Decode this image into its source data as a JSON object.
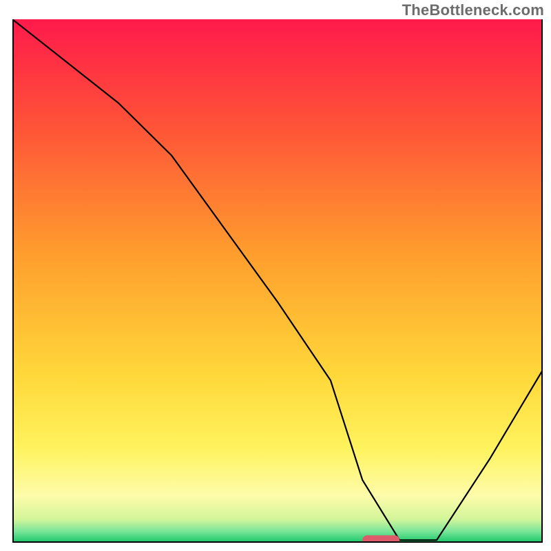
{
  "watermark": "TheBottleneck.com",
  "chart_data": {
    "type": "line",
    "title": "",
    "xlabel": "",
    "ylabel": "",
    "xlim": [
      0,
      100
    ],
    "ylim": [
      0,
      100
    ],
    "grid": false,
    "legend": null,
    "annotations": [],
    "x": [
      0,
      10,
      20,
      30,
      40,
      50,
      60,
      66,
      73,
      80,
      90,
      100
    ],
    "values": [
      100,
      92,
      84,
      74,
      60,
      46,
      31,
      12,
      0.5,
      0.5,
      16,
      33
    ],
    "marker": {
      "x_range": [
        66,
        73
      ],
      "y": 0.5,
      "color": "#dd5a6a"
    },
    "background_gradient": {
      "stops": [
        {
          "offset": 0.0,
          "color": "#ff1a4b"
        },
        {
          "offset": 0.2,
          "color": "#ff5238"
        },
        {
          "offset": 0.45,
          "color": "#ff9e2d"
        },
        {
          "offset": 0.68,
          "color": "#ffd83a"
        },
        {
          "offset": 0.82,
          "color": "#fff35e"
        },
        {
          "offset": 0.91,
          "color": "#fdfcaa"
        },
        {
          "offset": 0.955,
          "color": "#d3f59a"
        },
        {
          "offset": 0.978,
          "color": "#7ae69a"
        },
        {
          "offset": 1.0,
          "color": "#17c667"
        }
      ]
    }
  }
}
